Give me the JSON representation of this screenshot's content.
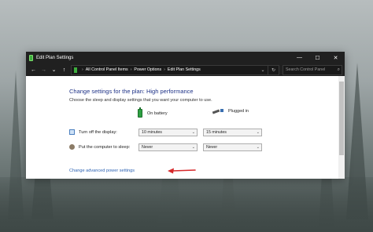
{
  "window": {
    "title": "Edit Plan Settings",
    "controls": {
      "minimize": "—",
      "maximize": "☐",
      "close": "✕"
    }
  },
  "address": {
    "back": "←",
    "forward": "→",
    "recent": "⌄",
    "up": "↑",
    "breadcrumbs": [
      "All Control Panel Items",
      "Power Options",
      "Edit Plan Settings"
    ],
    "separator": "›",
    "dropdown": "⌄",
    "refresh": "↻",
    "search_placeholder": "Search Control Panel",
    "search_icon": "⌕"
  },
  "main": {
    "heading": "Change settings for the plan: High performance",
    "subtext": "Choose the sleep and display settings that you want your computer to use.",
    "columns": {
      "battery": "On battery",
      "plugged": "Plugged in"
    },
    "rows": [
      {
        "label": "Turn off the display:",
        "battery_value": "10 minutes",
        "plugged_value": "15 minutes"
      },
      {
        "label": "Put the computer to sleep:",
        "battery_value": "Never",
        "plugged_value": "Never"
      }
    ],
    "chevron": "⌄",
    "advanced_link": "Change advanced power settings"
  },
  "colors": {
    "accent_arrow": "#d6282a",
    "link": "#2c62b3",
    "heading": "#1e3287"
  },
  "scrollbar": {
    "thumb_fraction": 0.72
  }
}
